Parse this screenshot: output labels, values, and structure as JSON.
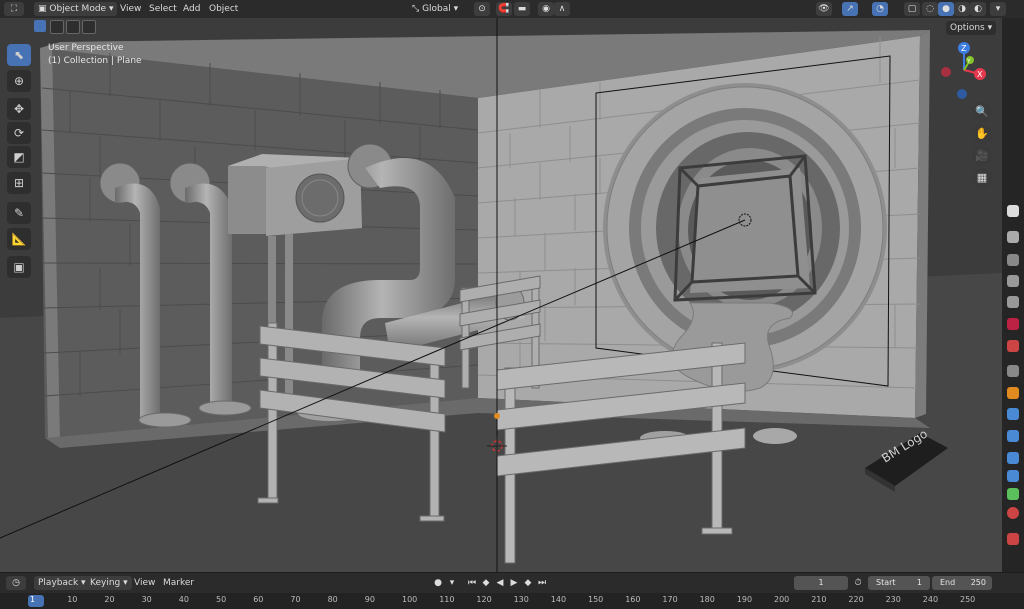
{
  "header": {
    "mode": "Object Mode",
    "menu": [
      "View",
      "Select",
      "Add",
      "Object"
    ],
    "orientation": "Global",
    "options": "Options"
  },
  "viewport": {
    "perspective": "User Perspective",
    "collection": "(1) Collection | Plane"
  },
  "scene": {
    "logo_text": "BM Logo"
  },
  "navigation": {
    "gizmo_x": "X",
    "gizmo_y": "Y",
    "gizmo_z": "Z"
  },
  "timeline": {
    "playback": "Playback",
    "keying": "Keying",
    "view": "View",
    "marker": "Marker",
    "current_frame": "1",
    "start_label": "Start",
    "start_value": "1",
    "end_label": "End",
    "end_value": "250",
    "ruler_ticks": [
      "1",
      "10",
      "20",
      "30",
      "40",
      "50",
      "60",
      "70",
      "80",
      "90",
      "100",
      "110",
      "120",
      "130",
      "140",
      "150",
      "160",
      "170",
      "180",
      "190",
      "200",
      "210",
      "220",
      "230",
      "240",
      "250"
    ]
  },
  "colors": {
    "accent": "#4772b3",
    "axis_x": "#e5394f",
    "axis_y": "#84c329",
    "axis_z": "#3d7de0"
  }
}
